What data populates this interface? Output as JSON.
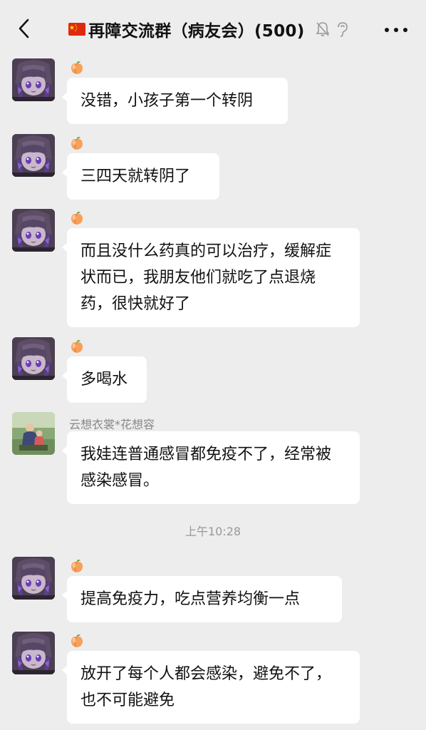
{
  "header": {
    "title": "再障交流群（病友会）(500)",
    "back_icon": "chevron-left-icon",
    "mute_icon": "bell-muted-icon",
    "ear_icon": "earpiece-icon",
    "more_icon": "more-horizontal-icon",
    "flag_icon": "china-flag-icon"
  },
  "messages": [
    {
      "sender_icon": "peach-emoji",
      "text": "没错，小孩子第一个转阴"
    },
    {
      "sender_icon": "peach-emoji",
      "text": "三四天就转阴了"
    },
    {
      "sender_icon": "peach-emoji",
      "text": "而且没什么药真的可以治疗，缓解症状而已，我朋友他们就吃了点退烧药，很快就好了"
    },
    {
      "sender_icon": "peach-emoji",
      "text": "多喝水"
    },
    {
      "nickname": "云想衣裳*花想容",
      "text": "我娃连普通感冒都免疫不了，经常被感染感冒。"
    },
    {
      "sender_icon": "peach-emoji",
      "text": "提高免疫力，吃点营养均衡一点"
    },
    {
      "sender_icon": "peach-emoji",
      "text": "放开了每个人都会感染，避免不了，也不可能避免"
    }
  ],
  "timestamp": "上午10:28",
  "colors": {
    "background": "#ededed",
    "bubble": "#ffffff",
    "nickname": "#888888",
    "timestamp": "#999999"
  }
}
